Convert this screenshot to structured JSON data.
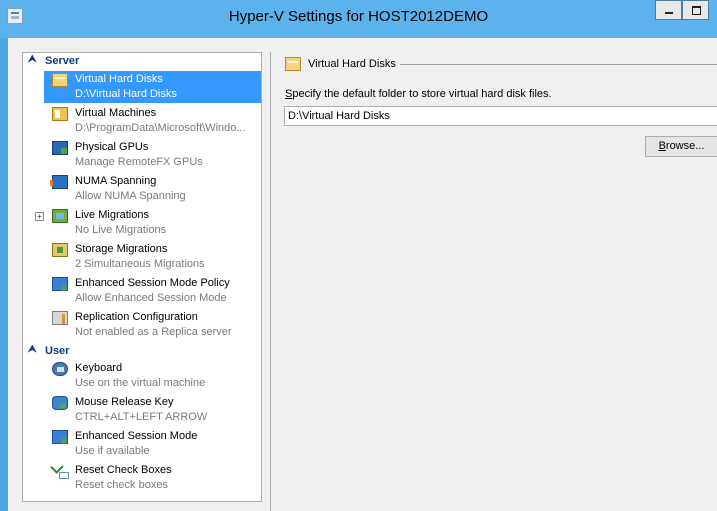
{
  "window": {
    "title": "Hyper-V Settings for HOST2012DEMO"
  },
  "sidebar": {
    "sections": [
      {
        "label": "Server"
      },
      {
        "label": "User"
      }
    ],
    "server_items": [
      {
        "label": "Virtual Hard Disks",
        "detail": "D:\\Virtual Hard Disks",
        "icon": "folder-icon",
        "selected": true
      },
      {
        "label": "Virtual Machines",
        "detail": "D:\\ProgramData\\Microsoft\\Windo...",
        "icon": "vm-folder-icon"
      },
      {
        "label": "Physical GPUs",
        "detail": "Manage RemoteFX GPUs",
        "icon": "gpu-icon"
      },
      {
        "label": "NUMA Spanning",
        "detail": "Allow NUMA Spanning",
        "icon": "numa-icon"
      },
      {
        "label": "Live Migrations",
        "detail": "No Live Migrations",
        "icon": "live-migration-icon",
        "expandable": true,
        "expander": "+"
      },
      {
        "label": "Storage Migrations",
        "detail": "2 Simultaneous Migrations",
        "icon": "storage-migration-icon"
      },
      {
        "label": "Enhanced Session Mode Policy",
        "detail": "Allow Enhanced Session Mode",
        "icon": "session-policy-icon"
      },
      {
        "label": "Replication Configuration",
        "detail": "Not enabled as a Replica server",
        "icon": "replication-icon"
      }
    ],
    "user_items": [
      {
        "label": "Keyboard",
        "detail": "Use on the virtual machine",
        "icon": "keyboard-icon"
      },
      {
        "label": "Mouse Release Key",
        "detail": "CTRL+ALT+LEFT ARROW",
        "icon": "mouse-icon"
      },
      {
        "label": "Enhanced Session Mode",
        "detail": "Use if available",
        "icon": "session-icon"
      },
      {
        "label": "Reset Check Boxes",
        "detail": "Reset check boxes",
        "icon": "reset-check-icon"
      }
    ],
    "collapse_glyph": "⮝"
  },
  "detail_panel": {
    "header": "Virtual Hard Disks",
    "description_first": "S",
    "description_rest": "pecify the default folder to store virtual hard disk files.",
    "path_value": "D:\\Virtual Hard Disks",
    "browse_first": "B",
    "browse_rest": "rowse..."
  }
}
